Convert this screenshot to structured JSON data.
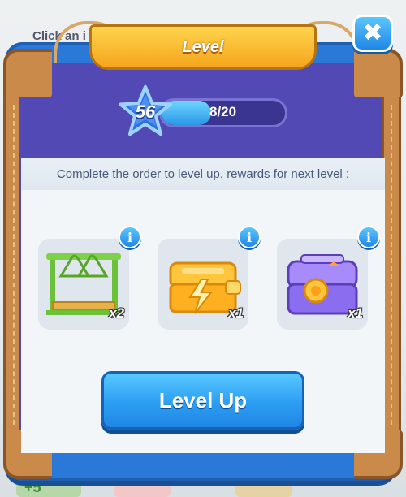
{
  "background": {
    "hint_text": "Click an i",
    "plus_text": "+5"
  },
  "popup": {
    "title": "Level",
    "close_glyph": "✖",
    "level": {
      "number": "56",
      "progress_text": "8/20",
      "progress_fraction": 0.4
    },
    "instruction": "Complete the order to level up, rewards for next level :",
    "rewards": [
      {
        "item": "clothes-rack",
        "quantity": "x2"
      },
      {
        "item": "orange-lightning-chest",
        "quantity": "x1"
      },
      {
        "item": "purple-coin-chest",
        "quantity": "x1"
      }
    ],
    "info_glyph": "i",
    "button_label": "Level Up"
  },
  "colors": {
    "frame_blue": "#2a78d8",
    "inner_purple": "#5249b4",
    "banner_gold": "#ffd44d",
    "button_blue": "#2c9ef2",
    "leather": "#c98a4a"
  }
}
